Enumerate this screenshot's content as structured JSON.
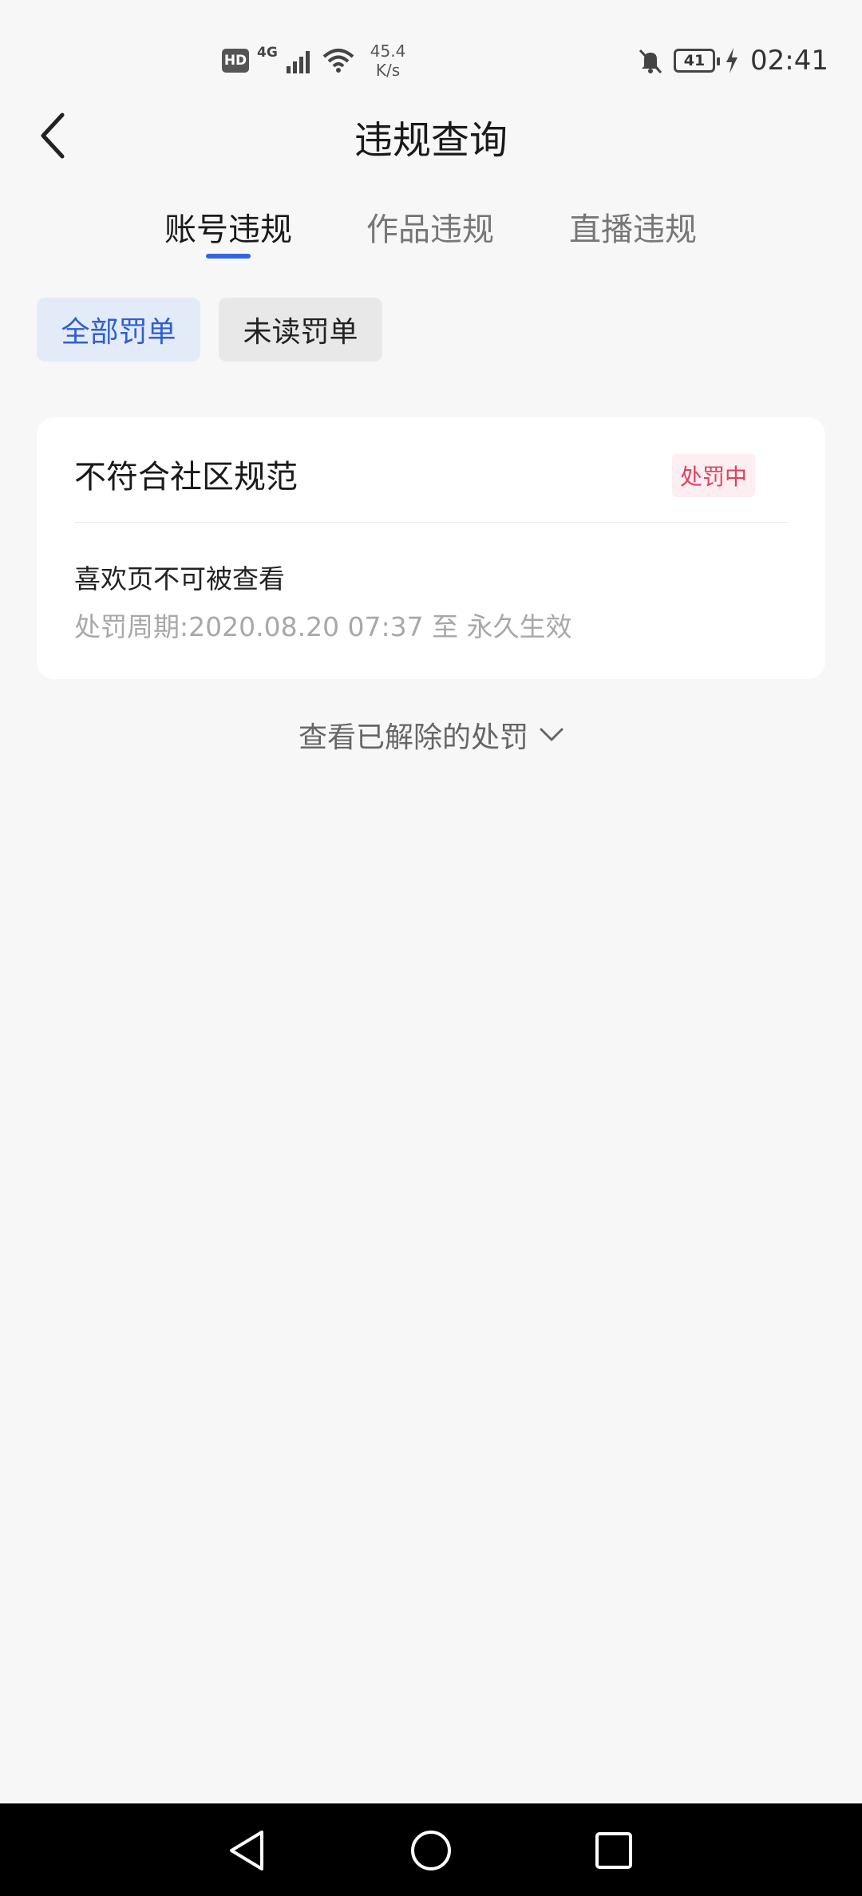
{
  "status_bar": {
    "hd": "HD",
    "network": "4G",
    "speed_value": "45.4",
    "speed_unit": "K/s",
    "battery": "41",
    "time": "02:41"
  },
  "header": {
    "title": "违规查询"
  },
  "tabs": [
    {
      "label": "账号违规",
      "active": true
    },
    {
      "label": "作品违规",
      "active": false
    },
    {
      "label": "直播违规",
      "active": false
    }
  ],
  "filters": [
    {
      "label": "全部罚单",
      "active": true
    },
    {
      "label": "未读罚单",
      "active": false
    }
  ],
  "penalty_card": {
    "title": "不符合社区规范",
    "status": "处罚中",
    "description": "喜欢页不可被查看",
    "period": "处罚周期:2020.08.20 07:37 至 永久生效"
  },
  "view_resolved": {
    "label": "查看已解除的处罚"
  },
  "colors": {
    "accent": "#3764e0",
    "status_red": "#e0425f",
    "background": "#f7f7f7"
  }
}
